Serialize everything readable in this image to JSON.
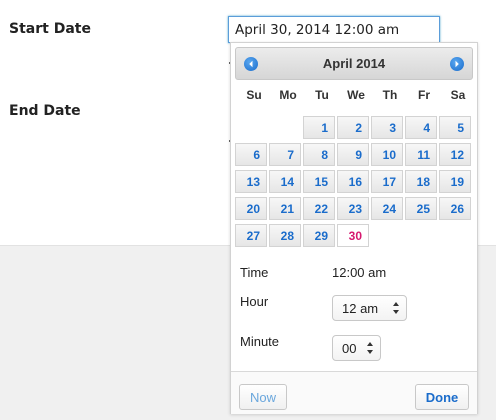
{
  "form": {
    "start_label": "Start Date",
    "end_label": "End Date",
    "start_value": "April 30, 2014 12:00 am"
  },
  "datepicker": {
    "month_title": "April 2014",
    "weekdays": [
      "Su",
      "Mo",
      "Tu",
      "We",
      "Th",
      "Fr",
      "Sa"
    ],
    "days": [
      [
        "",
        "",
        "1",
        "2",
        "3",
        "4",
        "5"
      ],
      [
        "6",
        "7",
        "8",
        "9",
        "10",
        "11",
        "12"
      ],
      [
        "13",
        "14",
        "15",
        "16",
        "17",
        "18",
        "19"
      ],
      [
        "20",
        "21",
        "22",
        "23",
        "24",
        "25",
        "26"
      ],
      [
        "27",
        "28",
        "29",
        "30",
        "",
        "",
        ""
      ]
    ],
    "highlight_day": "30",
    "time": {
      "label": "Time",
      "value": "12:00 am"
    },
    "hour": {
      "label": "Hour",
      "value": "12 am"
    },
    "minute": {
      "label": "Minute",
      "value": "00"
    },
    "now_label": "Now",
    "done_label": "Done",
    "colors": {
      "day_link": "#1a6ccb",
      "today": "#d6186f",
      "nav_icon": "#1a6ccb"
    },
    "icons": {
      "prev": "chevron-left-icon",
      "next": "chevron-right-icon"
    }
  }
}
